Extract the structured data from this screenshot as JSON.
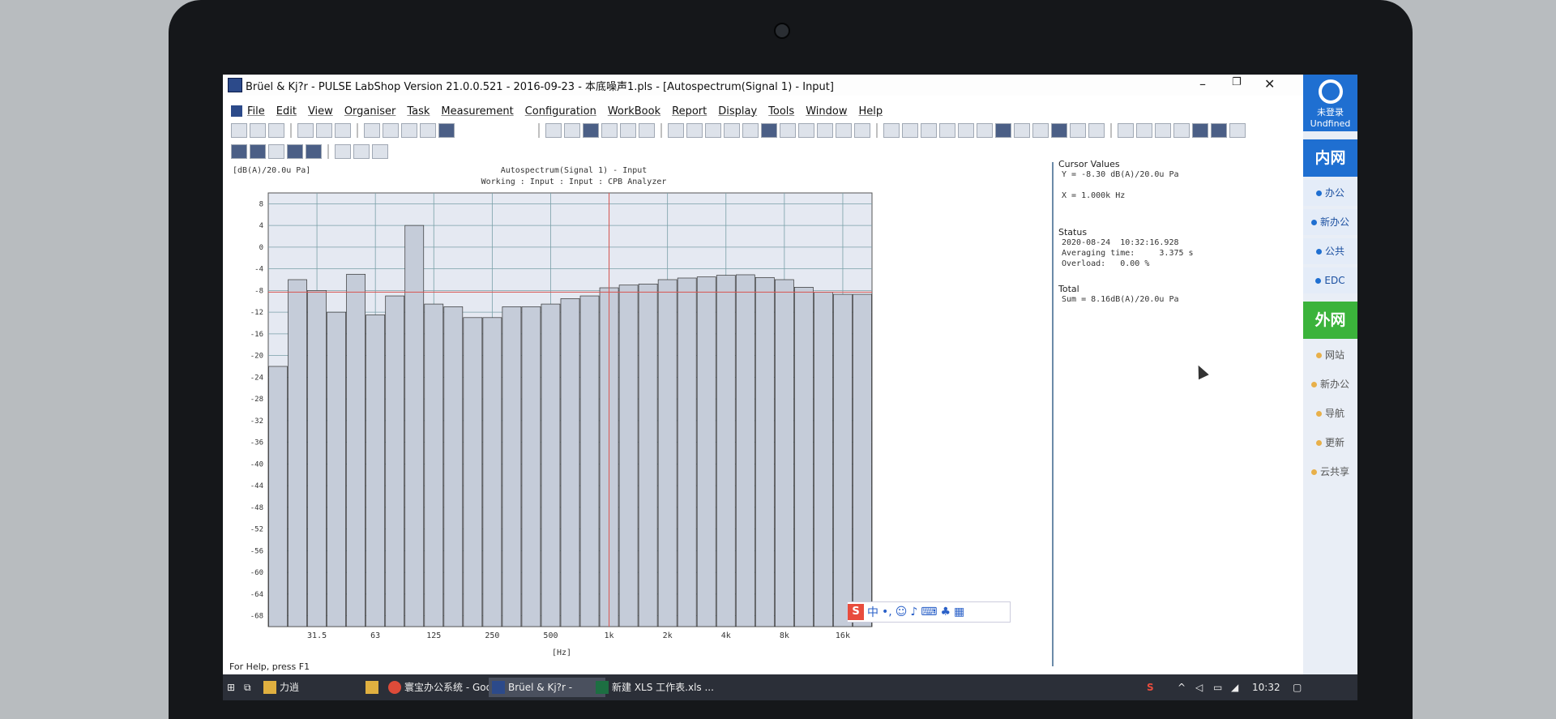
{
  "window": {
    "title": "Brüel & Kj?r - PULSE LabShop  Version 21.0.0.521 - 2016-09-23 - 本底噪声1.pls - [Autospectrum(Signal 1) - Input]"
  },
  "menu": [
    "File",
    "Edit",
    "View",
    "Organiser",
    "Task",
    "Measurement",
    "Configuration",
    "WorkBook",
    "Report",
    "Display",
    "Tools",
    "Window",
    "Help"
  ],
  "chart_data": {
    "type": "bar",
    "title": "Autospectrum(Signal 1) - Input",
    "subtitle": "Working : Input : Input : CPB Analyzer",
    "ylabel": "[dB(A)/20.0u Pa]",
    "xlabel": "[Hz]",
    "ylim": [
      -70,
      10
    ],
    "yticks": [
      8,
      4,
      0,
      -4,
      -8,
      -12,
      -16,
      -20,
      -24,
      -28,
      -32,
      -36,
      -40,
      -44,
      -48,
      -52,
      -56,
      -60,
      -64,
      -68
    ],
    "xtick_labels": [
      "31.5",
      "63",
      "125",
      "250",
      "500",
      "1k",
      "2k",
      "4k",
      "8k",
      "16k"
    ],
    "values": [
      -22,
      -6,
      -8,
      -12,
      -5,
      -12.5,
      -9,
      4,
      -10.5,
      -11,
      -13,
      -13,
      -11,
      -11,
      -10.5,
      -9.5,
      -9,
      -7.5,
      -7,
      -6.8,
      -6,
      -5.7,
      -5.5,
      -5.2,
      -5.1,
      -5.6,
      -6,
      -7.4,
      -8.3,
      -8.7,
      -8.7
    ],
    "cursor_y": -8.3,
    "cursor_x_index": 17,
    "grid": true
  },
  "cursor_values": {
    "heading": "Cursor Values",
    "y": "Y = -8.30 dB(A)/20.0u Pa",
    "x": "X = 1.000k Hz"
  },
  "status": {
    "heading": "Status",
    "timestamp": "2020-08-24  10:32:16.928",
    "averaging": "Averaging time:     3.375 s",
    "overload": "Overload:   0.00 %"
  },
  "total": {
    "heading": "Total",
    "sum": "Sum = 8.16dB(A)/20.0u Pa"
  },
  "sidebar": {
    "login": "未登录",
    "undefined": "Undfined",
    "inner": "内网",
    "inner_items": [
      "办公",
      "新办公",
      "公共",
      "EDC"
    ],
    "outer": "外网",
    "outer_items": [
      "网站",
      "新办公",
      "导航",
      "更新",
      "云共享"
    ]
  },
  "statusbar": {
    "help": "For Help, press F1"
  },
  "ime": {
    "mode": "中"
  },
  "taskbar": {
    "items": [
      "力逍",
      "寰宝办公系统 - Goo...",
      "Brüel & Kj?r - PULS...",
      "新建 XLS 工作表.xls ..."
    ],
    "time": "10:32"
  },
  "colors": {
    "bar_fill": "#c5ccd9",
    "grid": "#7aa0a8",
    "cursor": "#d9534f",
    "plot_bg": "#e5e9f2"
  }
}
